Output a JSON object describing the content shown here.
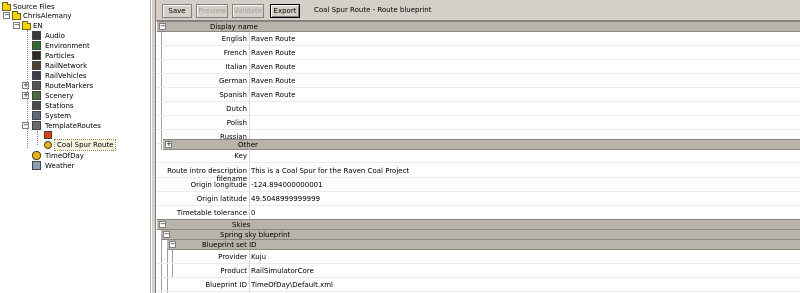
{
  "tree": {
    "root": "Source Files",
    "author": "ChrisAlemany",
    "lang": "EN",
    "items": [
      {
        "label": "Audio",
        "icon": "audio-icon"
      },
      {
        "label": "Environment",
        "icon": "environment-icon"
      },
      {
        "label": "Particles",
        "icon": "particles-icon"
      },
      {
        "label": "RailNetwork",
        "icon": "railnetwork-icon"
      },
      {
        "label": "RailVehicles",
        "icon": "railvehicles-icon"
      },
      {
        "label": "RouteMarkers",
        "icon": "routemarkers-icon"
      },
      {
        "label": "Scenery",
        "icon": "scenery-icon"
      },
      {
        "label": "Stations",
        "icon": "stations-icon"
      },
      {
        "label": "System",
        "icon": "system-icon"
      },
      {
        "label": "TemplateRoutes",
        "icon": "templateroutes-icon"
      }
    ],
    "selected": "Coal Spur Route",
    "after": [
      {
        "label": "TimeOfDay"
      },
      {
        "label": "Weather"
      }
    ]
  },
  "toolbar": {
    "save": "Save",
    "preview": "Preview",
    "validate": "Validate",
    "export": "Export",
    "title": "Coal Spur Route - Route blueprint"
  },
  "form": {
    "display_name_header": "Display name",
    "languages": [
      {
        "label": "English",
        "value": "Raven Route"
      },
      {
        "label": "French",
        "value": "Raven Route"
      },
      {
        "label": "Italian",
        "value": "Raven Route"
      },
      {
        "label": "German",
        "value": "Raven Route"
      },
      {
        "label": "Spanish",
        "value": "Raven Route"
      },
      {
        "label": "Dutch",
        "value": ""
      },
      {
        "label": "Polish",
        "value": ""
      },
      {
        "label": "Russian",
        "value": ""
      }
    ],
    "other_header": "Other",
    "key_label": "Key",
    "fields": [
      {
        "label": "Route intro description filename",
        "value": "This is a Coal Spur for the Raven Coal Project"
      },
      {
        "label": "Origin longitude",
        "value": "-124.894000000001"
      },
      {
        "label": "Origin latitude",
        "value": "49.5048999999999"
      },
      {
        "label": "Timetable tolerance",
        "value": "0"
      }
    ],
    "skies_header": "Skies",
    "spring_header": "Spring sky blueprint",
    "blueprint_set_header": "Blueprint set ID",
    "provider_label": "Provider",
    "provider_value": "Kuju",
    "product_label": "Product",
    "product_value": "RailSimulatorCore",
    "blueprint_id_label": "Blueprint ID",
    "blueprint_id_value": "TimeOfDay\\Default.xml"
  }
}
